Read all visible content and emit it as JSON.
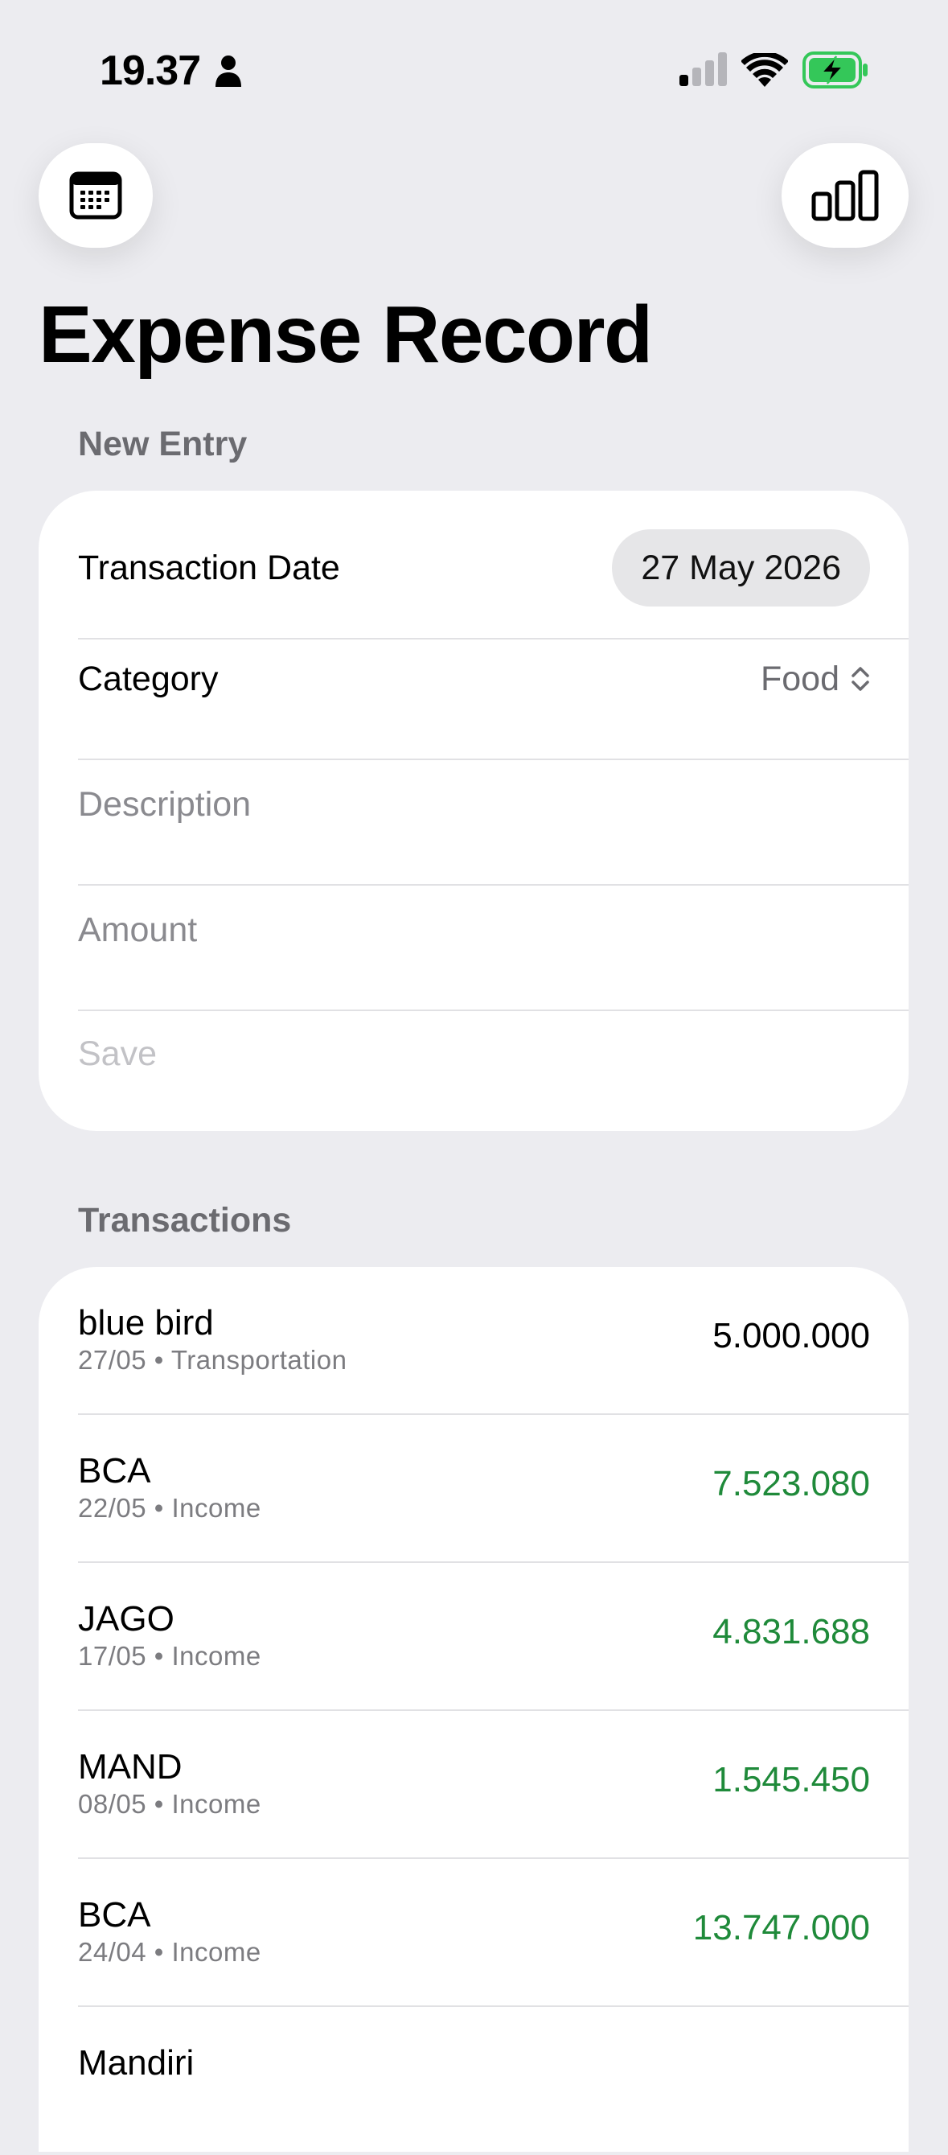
{
  "status_bar": {
    "time": "19.37",
    "icons": [
      "person-icon",
      "cellular-signal-icon",
      "wifi-icon",
      "battery-charging-icon"
    ],
    "battery_color": "#34c759"
  },
  "toolbar": {
    "left_icon": "calendar-icon",
    "right_icon": "bar-chart-icon"
  },
  "page": {
    "title": "Expense Record"
  },
  "new_entry": {
    "header": "New Entry",
    "date_label": "Transaction Date",
    "date_value": "27 May 2026",
    "category_label": "Category",
    "category_value": "Food",
    "description_placeholder": "Description",
    "amount_placeholder": "Amount",
    "save_label": "Save"
  },
  "transactions": {
    "header": "Transactions",
    "items": [
      {
        "name": "blue bird",
        "meta": "27/05 • Transportation",
        "amount": "5.000.000",
        "type": "expense"
      },
      {
        "name": "BCA",
        "meta": "22/05 • Income",
        "amount": "7.523.080",
        "type": "income"
      },
      {
        "name": "JAGO",
        "meta": "17/05 • Income",
        "amount": "4.831.688",
        "type": "income"
      },
      {
        "name": "MAND",
        "meta": "08/05 • Income",
        "amount": "1.545.450",
        "type": "income"
      },
      {
        "name": "BCA",
        "meta": "24/04 • Income",
        "amount": "13.747.000",
        "type": "income"
      },
      {
        "name": "Mandiri",
        "meta": "",
        "amount": "",
        "type": "income"
      }
    ]
  },
  "colors": {
    "background": "#ececf0",
    "card": "#ffffff",
    "income": "#1f8a3a",
    "secondary_text": "#6b6b70"
  }
}
